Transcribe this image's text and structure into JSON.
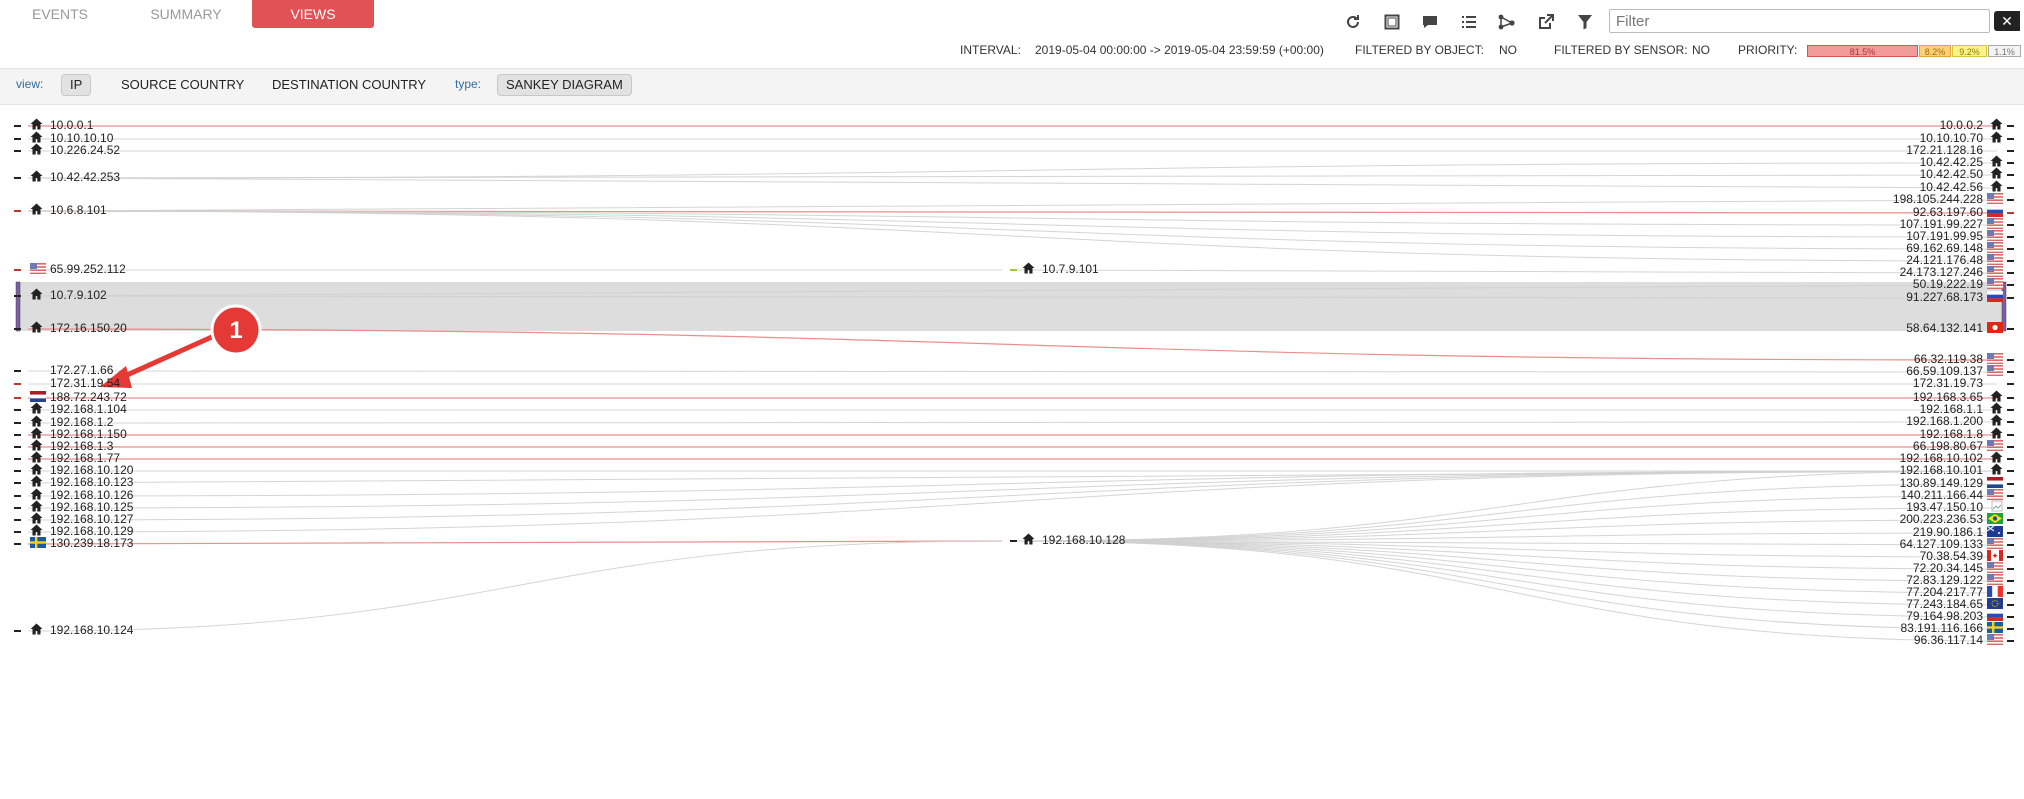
{
  "tabs": [
    {
      "label": "EVENTS",
      "active": false
    },
    {
      "label": "SUMMARY",
      "active": false
    },
    {
      "label": "VIEWS",
      "active": true
    }
  ],
  "toolbar": {
    "icons": [
      "refresh-icon",
      "fullscreen-icon",
      "comment-icon",
      "list-icon",
      "graph-icon",
      "external-link-icon",
      "filter-icon"
    ],
    "filter_placeholder": "Filter",
    "clear_label": "✕"
  },
  "info": {
    "interval_label": "INTERVAL:",
    "interval_value": "2019-05-04 00:00:00 -> 2019-05-04 23:59:59 (+00:00)",
    "filtered_object_label": "FILTERED BY OBJECT:",
    "filtered_object_value": "NO",
    "filtered_sensor_label": "FILTERED BY SENSOR:",
    "filtered_sensor_value": "NO",
    "priority_label": "PRIORITY:",
    "priority_bars": [
      {
        "label": "81.5%",
        "bg": "#f19a9a",
        "border": "#d9534f",
        "color": "#a33"
      },
      {
        "label": "8.2%",
        "bg": "#fbd27a",
        "border": "#e6a33a",
        "color": "#a36b00"
      },
      {
        "label": "9.2%",
        "bg": "#fbf387",
        "border": "#d4c73a",
        "color": "#8a7d00"
      },
      {
        "label": "1.1%",
        "bg": "#f3f3f3",
        "border": "#aaaaaa",
        "color": "#777"
      }
    ]
  },
  "viewbar": {
    "view_label": "view:",
    "view_options": [
      {
        "label": "IP",
        "selected": true
      },
      {
        "label": "SOURCE COUNTRY",
        "selected": false
      },
      {
        "label": "DESTINATION COUNTRY",
        "selected": false
      }
    ],
    "type_label": "type:",
    "type_options": [
      {
        "label": "SANKEY DIAGRAM",
        "selected": true
      }
    ]
  },
  "colors": {
    "accent": "#e05256",
    "flow_red": "#e8837f",
    "flow_gray": "#cfcfcf",
    "highlight": "#dddddd",
    "callout": "#e53935"
  },
  "callout": {
    "number": "1"
  },
  "sankey": {
    "left": [
      {
        "ip": "10.0.0.1",
        "icon": "home-icon"
      },
      {
        "ip": "10.10.10.10",
        "icon": "home-icon"
      },
      {
        "ip": "10.226.24.52",
        "icon": "home-icon"
      },
      {
        "ip": "10.42.42.253",
        "icon": "home-icon"
      },
      {
        "ip": "10.6.8.101",
        "icon": "home-icon"
      },
      {
        "ip": "65.99.252.112",
        "icon": "flag-us-icon"
      },
      {
        "ip": "10.7.9.102",
        "icon": "home-icon"
      },
      {
        "ip": "172.16.150.20",
        "icon": "home-icon",
        "highlight": true
      },
      {
        "ip": "172.27.1.66",
        "icon": ""
      },
      {
        "ip": "172.31.19.54",
        "icon": ""
      },
      {
        "ip": "188.72.243.72",
        "icon": "flag-nl-icon"
      },
      {
        "ip": "192.168.1.104",
        "icon": "home-icon"
      },
      {
        "ip": "192.168.1.2",
        "icon": "home-icon"
      },
      {
        "ip": "192.168.1.150",
        "icon": "home-icon"
      },
      {
        "ip": "192.168.1.3",
        "icon": "home-icon"
      },
      {
        "ip": "192.168.1.77",
        "icon": "home-icon"
      },
      {
        "ip": "192.168.10.120",
        "icon": "home-icon"
      },
      {
        "ip": "192.168.10.123",
        "icon": "home-icon"
      },
      {
        "ip": "192.168.10.126",
        "icon": "home-icon"
      },
      {
        "ip": "192.168.10.125",
        "icon": "home-icon"
      },
      {
        "ip": "192.168.10.127",
        "icon": "home-icon"
      },
      {
        "ip": "192.168.10.129",
        "icon": "home-icon"
      },
      {
        "ip": "130.239.18.173",
        "icon": "flag-se-icon"
      },
      {
        "ip": "192.168.10.124",
        "icon": "home-icon"
      }
    ],
    "middle": [
      {
        "ip": "10.7.9.101",
        "icon": "home-icon"
      },
      {
        "ip": "192.168.10.128",
        "icon": "home-icon"
      }
    ],
    "right": [
      {
        "ip": "10.0.0.2",
        "icon": "home-icon"
      },
      {
        "ip": "10.10.10.70",
        "icon": "home-icon"
      },
      {
        "ip": "172.21.128.16",
        "icon": ""
      },
      {
        "ip": "10.42.42.25",
        "icon": "home-icon"
      },
      {
        "ip": "10.42.42.50",
        "icon": "home-icon"
      },
      {
        "ip": "10.42.42.56",
        "icon": "home-icon"
      },
      {
        "ip": "198.105.244.228",
        "icon": "flag-us-icon"
      },
      {
        "ip": "92.63.197.60",
        "icon": "flag-ru-icon"
      },
      {
        "ip": "107.191.99.227",
        "icon": "flag-us-icon"
      },
      {
        "ip": "107.191.99.95",
        "icon": "flag-us-icon"
      },
      {
        "ip": "69.162.69.148",
        "icon": "flag-us-icon"
      },
      {
        "ip": "24.121.176.48",
        "icon": "flag-us-icon"
      },
      {
        "ip": "24.173.127.246",
        "icon": "flag-us-icon"
      },
      {
        "ip": "50.19.222.19",
        "icon": "flag-us-icon"
      },
      {
        "ip": "91.227.68.173",
        "icon": "flag-ru-icon"
      },
      {
        "ip": "58.64.132.141",
        "icon": "flag-hk-icon",
        "highlight": true
      },
      {
        "ip": "66.32.119.38",
        "icon": "flag-us-icon"
      },
      {
        "ip": "66.59.109.137",
        "icon": "flag-us-icon"
      },
      {
        "ip": "172.31.19.73",
        "icon": ""
      },
      {
        "ip": "192.168.3.65",
        "icon": "home-icon"
      },
      {
        "ip": "192.168.1.1",
        "icon": "home-icon"
      },
      {
        "ip": "192.168.1.200",
        "icon": "home-icon"
      },
      {
        "ip": "192.168.1.8",
        "icon": "home-icon"
      },
      {
        "ip": "66.198.80.67",
        "icon": "flag-us-icon"
      },
      {
        "ip": "192.168.10.102",
        "icon": "home-icon"
      },
      {
        "ip": "192.168.10.101",
        "icon": "home-icon"
      },
      {
        "ip": "130.89.149.129",
        "icon": "flag-nl-icon"
      },
      {
        "ip": "140.211.166.44",
        "icon": "flag-us-icon"
      },
      {
        "ip": "193.47.150.10",
        "icon": "broken-image-icon"
      },
      {
        "ip": "200.223.236.53",
        "icon": "flag-br-icon"
      },
      {
        "ip": "219.90.186.1",
        "icon": "flag-au-icon"
      },
      {
        "ip": "64.127.109.133",
        "icon": "flag-us-icon"
      },
      {
        "ip": "70.38.54.39",
        "icon": "flag-ca-icon"
      },
      {
        "ip": "72.20.34.145",
        "icon": "flag-us-icon"
      },
      {
        "ip": "72.83.129.122",
        "icon": "flag-us-icon"
      },
      {
        "ip": "77.204.217.77",
        "icon": "flag-fr-icon"
      },
      {
        "ip": "77.243.184.65",
        "icon": "flag-eu-icon"
      },
      {
        "ip": "79.164.98.203",
        "icon": "flag-ru-icon"
      },
      {
        "ip": "83.191.116.166",
        "icon": "flag-se-icon"
      },
      {
        "ip": "96.36.117.14",
        "icon": "flag-us-icon"
      }
    ],
    "links": [
      {
        "from": "L:10.0.0.1",
        "to": "R:10.0.0.2",
        "kind": "red"
      },
      {
        "from": "L:10.10.10.10",
        "to": "R:10.10.10.70",
        "kind": "gray"
      },
      {
        "from": "L:10.226.24.52",
        "to": "R:172.21.128.16",
        "kind": "gray"
      },
      {
        "from": "L:10.42.42.253",
        "to": "R:10.42.42.25",
        "kind": "gray"
      },
      {
        "from": "L:10.42.42.253",
        "to": "R:10.42.42.50",
        "kind": "gray"
      },
      {
        "from": "L:10.42.42.253",
        "to": "R:10.42.42.56",
        "kind": "gray"
      },
      {
        "from": "L:10.6.8.101",
        "to": "R:198.105.244.228",
        "kind": "gray"
      },
      {
        "from": "L:10.6.8.101",
        "to": "R:92.63.197.60",
        "kind": "red"
      },
      {
        "from": "L:10.6.8.101",
        "to": "R:107.191.99.227",
        "kind": "gray"
      },
      {
        "from": "L:10.6.8.101",
        "to": "R:107.191.99.95",
        "kind": "gray"
      },
      {
        "from": "L:10.6.8.101",
        "to": "R:69.162.69.148",
        "kind": "gray"
      },
      {
        "from": "L:10.6.8.101",
        "to": "R:24.121.176.48",
        "kind": "gray"
      },
      {
        "from": "L:65.99.252.112",
        "to": "M:10.7.9.101",
        "kind": "gray"
      },
      {
        "from": "M:10.7.9.101",
        "to": "R:24.173.127.246",
        "kind": "gray"
      },
      {
        "from": "L:10.7.9.102",
        "to": "R:50.19.222.19",
        "kind": "gray"
      },
      {
        "from": "L:10.7.9.102",
        "to": "R:91.227.68.173",
        "kind": "gray"
      },
      {
        "from": "L:172.16.150.20",
        "to": "R:58.64.132.141",
        "kind": "highlight"
      },
      {
        "from": "L:172.16.150.20",
        "to": "R:66.32.119.38",
        "kind": "red"
      },
      {
        "from": "L:172.27.1.66",
        "to": "R:66.59.109.137",
        "kind": "gray"
      },
      {
        "from": "L:172.31.19.54",
        "to": "R:172.31.19.73",
        "kind": "gray"
      },
      {
        "from": "L:188.72.243.72",
        "to": "R:192.168.3.65",
        "kind": "red"
      },
      {
        "from": "L:192.168.1.104",
        "to": "R:192.168.1.1",
        "kind": "gray"
      },
      {
        "from": "L:192.168.1.2",
        "to": "R:192.168.1.200",
        "kind": "gray"
      },
      {
        "from": "L:192.168.1.150",
        "to": "R:192.168.1.8",
        "kind": "red"
      },
      {
        "from": "L:192.168.1.3",
        "to": "R:66.198.80.67",
        "kind": "red"
      },
      {
        "from": "L:192.168.1.77",
        "to": "R:192.168.10.102",
        "kind": "red"
      },
      {
        "from": "L:192.168.10.120",
        "to": "R:192.168.10.101",
        "kind": "gray"
      },
      {
        "from": "L:192.168.10.123",
        "to": "R:192.168.10.101",
        "kind": "gray"
      },
      {
        "from": "L:192.168.10.126",
        "to": "R:192.168.10.101",
        "kind": "gray"
      },
      {
        "from": "L:192.168.10.125",
        "to": "R:192.168.10.101",
        "kind": "gray"
      },
      {
        "from": "L:192.168.10.127",
        "to": "R:192.168.10.101",
        "kind": "gray"
      },
      {
        "from": "L:192.168.10.129",
        "to": "R:192.168.10.101",
        "kind": "gray"
      },
      {
        "from": "L:130.239.18.173",
        "to": "M:192.168.10.128",
        "kind": "red"
      },
      {
        "from": "L:192.168.10.124",
        "to": "M:192.168.10.128",
        "kind": "gray"
      },
      {
        "from": "M:192.168.10.128",
        "to": "R:192.168.10.101",
        "kind": "gray"
      },
      {
        "from": "M:192.168.10.128",
        "to": "R:130.89.149.129",
        "kind": "gray"
      },
      {
        "from": "M:192.168.10.128",
        "to": "R:140.211.166.44",
        "kind": "gray"
      },
      {
        "from": "M:192.168.10.128",
        "to": "R:193.47.150.10",
        "kind": "gray"
      },
      {
        "from": "M:192.168.10.128",
        "to": "R:200.223.236.53",
        "kind": "gray"
      },
      {
        "from": "M:192.168.10.128",
        "to": "R:219.90.186.1",
        "kind": "gray"
      },
      {
        "from": "M:192.168.10.128",
        "to": "R:64.127.109.133",
        "kind": "gray"
      },
      {
        "from": "M:192.168.10.128",
        "to": "R:70.38.54.39",
        "kind": "gray"
      },
      {
        "from": "M:192.168.10.128",
        "to": "R:72.20.34.145",
        "kind": "gray"
      },
      {
        "from": "M:192.168.10.128",
        "to": "R:72.83.129.122",
        "kind": "gray"
      },
      {
        "from": "M:192.168.10.128",
        "to": "R:77.204.217.77",
        "kind": "gray"
      },
      {
        "from": "M:192.168.10.128",
        "to": "R:77.243.184.65",
        "kind": "gray"
      },
      {
        "from": "M:192.168.10.128",
        "to": "R:79.164.98.203",
        "kind": "gray"
      },
      {
        "from": "M:192.168.10.128",
        "to": "R:83.191.116.166",
        "kind": "gray"
      },
      {
        "from": "M:192.168.10.128",
        "to": "R:96.36.117.14",
        "kind": "gray"
      }
    ]
  }
}
